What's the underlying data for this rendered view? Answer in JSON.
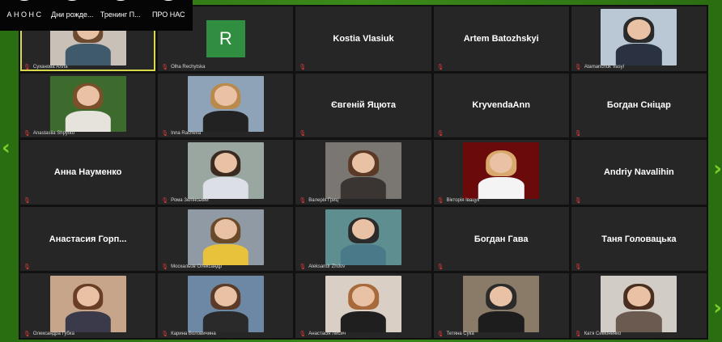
{
  "stories": [
    {
      "label": "А Н О Н С"
    },
    {
      "label": "Дни рожде..."
    },
    {
      "label": "Тренинг П..."
    },
    {
      "label": "ПРО НАС"
    }
  ],
  "tiles": [
    {
      "type": "video",
      "label": "Суханова Алла",
      "active": true,
      "bg": "#c9c1b7",
      "hair": "#6b4a2f",
      "shirt": "#3f5a6a"
    },
    {
      "type": "avatar",
      "avatar_letter": "R",
      "label": "Olha Rechytska"
    },
    {
      "type": "name",
      "name": "Kostia Vlasiuk"
    },
    {
      "type": "name",
      "name": "Artem Batozhskyi"
    },
    {
      "type": "video",
      "label": "Atamanchuk Vasyl",
      "bg": "#b9c8d4",
      "hair": "#2a2a2a",
      "shirt": "#2a3140"
    },
    {
      "type": "video",
      "label": "Anastasiia Shpytko",
      "bg": "#3d6b2e",
      "hair": "#7a4f2a",
      "shirt": "#e6e2dc"
    },
    {
      "type": "video",
      "label": "Inna Racheva",
      "bg": "#8fa3b8",
      "hair": "#b98a4c",
      "shirt": "#222"
    },
    {
      "type": "name",
      "name": "Євгеній Яцюта"
    },
    {
      "type": "name",
      "name": "KryvendaAnn"
    },
    {
      "type": "name",
      "name": "Богдан Сніцар"
    },
    {
      "type": "name",
      "name": "Анна Науменко"
    },
    {
      "type": "video",
      "label": "Рома Зелінський",
      "bg": "#9aa7a1",
      "hair": "#3a2a1f",
      "shirt": "#dcdfe6"
    },
    {
      "type": "video",
      "label": "Валерія Гриц",
      "bg": "#7a7672",
      "hair": "#5a3a26",
      "shirt": "#3a3533"
    },
    {
      "type": "video",
      "label": "Вікторія Івацук",
      "bg": "#6a0a0a",
      "hair": "#d9a86c",
      "shirt": "#f4f4f4"
    },
    {
      "type": "name",
      "name": "Andriy Navalihin"
    },
    {
      "type": "name",
      "name": "Анастасия  Горп..."
    },
    {
      "type": "video",
      "label": "Москальов Олександр",
      "bg": "#8f9aa4",
      "hair": "#6a4a2a",
      "shirt": "#e7c23a"
    },
    {
      "type": "video",
      "label": "Aleksandr Zhdov",
      "bg": "#5e8e8f",
      "hair": "#2b2b2b",
      "shirt": "#4a7a8a"
    },
    {
      "type": "name",
      "name": "Богдан Гава"
    },
    {
      "type": "name",
      "name": "Таня Головацька"
    },
    {
      "type": "video",
      "label": "Олександра Губка",
      "bg": "#c7a58b",
      "hair": "#6a3e24",
      "shirt": "#3a3a4a"
    },
    {
      "type": "video",
      "label": "Карина Воловичина",
      "bg": "#6d88a5",
      "hair": "#5b3b27",
      "shirt": "#2a2a2a"
    },
    {
      "type": "video",
      "label": "Анастасія Лисич",
      "bg": "#d9cfc4",
      "hair": "#a86a3a",
      "shirt": "#1f1f1f"
    },
    {
      "type": "video",
      "label": "Тетяна Сука",
      "bg": "#8a7a68",
      "hair": "#2b2b2b",
      "shirt": "#1d1d1d"
    },
    {
      "type": "video",
      "label": "Катя Симоненко",
      "bg": "#d2ccc6",
      "hair": "#4a2e20",
      "shirt": "#6a5a50"
    }
  ]
}
